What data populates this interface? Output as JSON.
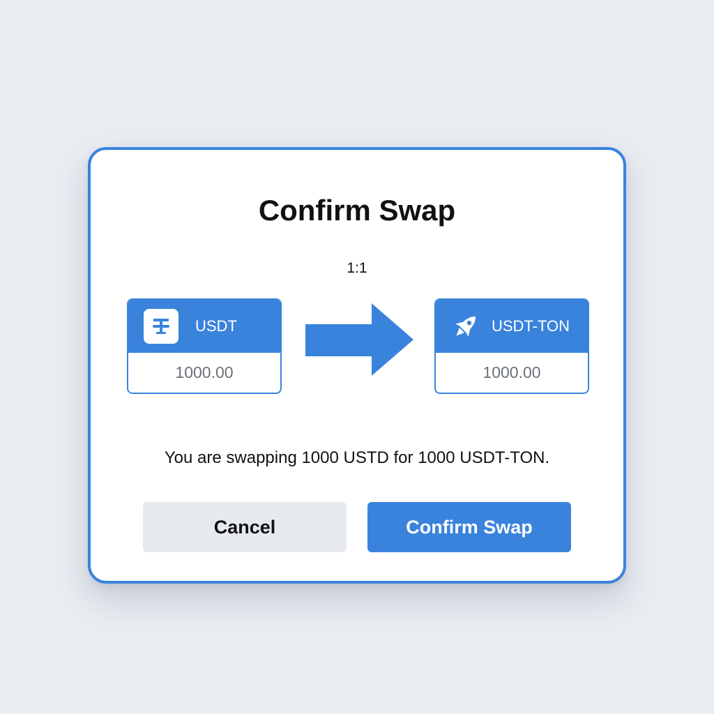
{
  "dialog": {
    "title": "Confirm Swap",
    "rate": "1:1",
    "from_token": {
      "name": "USDT",
      "amount": "1000.00",
      "icon": "tether-icon"
    },
    "to_token": {
      "name": "USDT-TON",
      "amount": "1000.00",
      "icon": "rocket-icon"
    },
    "message": "You are swapping 1000 USTD for 1000 USDT-TON.",
    "cancel_label": "Cancel",
    "confirm_label": "Confirm Swap"
  },
  "colors": {
    "accent": "#3a83dd",
    "background": "#e9ecf1",
    "cancel_bg": "#e6e9ed",
    "amount_text": "#6b7178"
  }
}
